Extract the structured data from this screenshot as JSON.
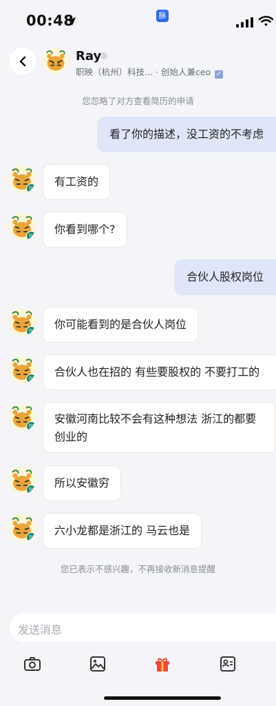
{
  "status_bar": {
    "time": "00:48",
    "app_badge": "脉"
  },
  "header": {
    "name": "Ray",
    "subtitle": "职映（杭州）科技... · 创始人兼ceo",
    "check_glyph": "✓"
  },
  "notices": {
    "top": "您忽略了对方查看简历的申请",
    "bottom": "您已表示不感兴趣，不再接收新消息提醒"
  },
  "messages": [
    {
      "side": "right",
      "text": "看了你的描述，没工资的不考虑"
    },
    {
      "side": "left",
      "text": "有工资的"
    },
    {
      "side": "left",
      "text": "你看到哪个?"
    },
    {
      "side": "right",
      "text": "合伙人股权岗位"
    },
    {
      "side": "left",
      "text": "你可能看到的是合伙人岗位"
    },
    {
      "side": "left",
      "text": "合伙人也在招的 有些要股权的 不要打工的"
    },
    {
      "side": "left",
      "text": "安徽河南比较不会有这种想法 浙江的都要创业的"
    },
    {
      "side": "left",
      "text": "所以安徽穷"
    },
    {
      "side": "left",
      "text": "六小龙都是浙江的 马云也是"
    }
  ],
  "avatar_level": "IV",
  "input": {
    "placeholder": "发送消息"
  },
  "toolbar": [
    "camera-icon",
    "image-icon",
    "gift-icon",
    "contact-card-icon"
  ],
  "colors": {
    "accent": "#2f6bea",
    "sent_bubble": "#dfe6f9",
    "gift": "#ee4a3c"
  }
}
